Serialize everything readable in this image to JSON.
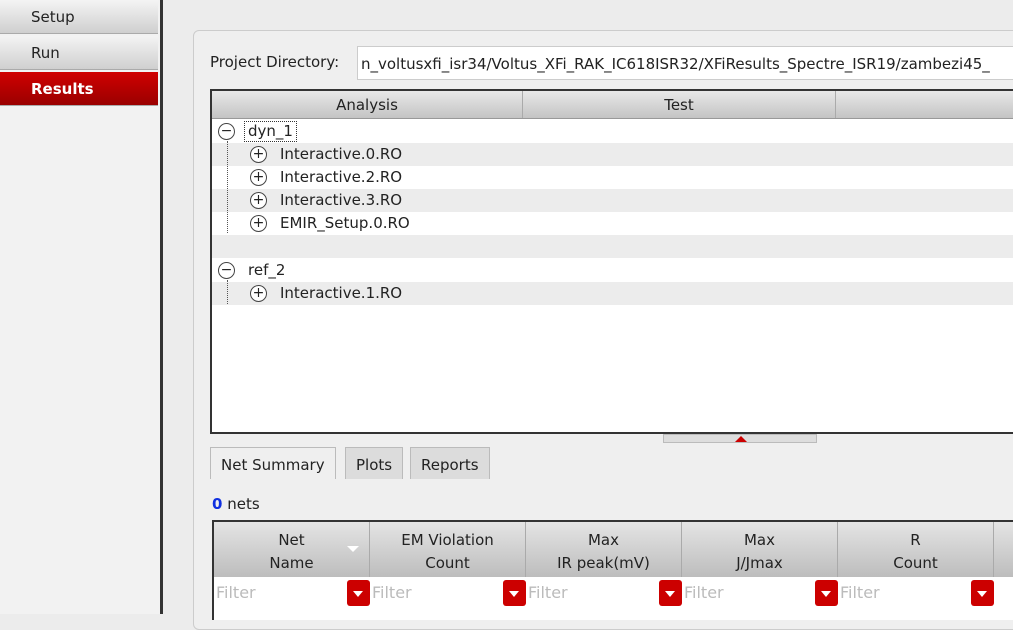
{
  "sidebar": {
    "items": [
      {
        "label": "Setup"
      },
      {
        "label": "Run"
      },
      {
        "label": "Results",
        "active": true
      }
    ]
  },
  "project": {
    "label": "Project Directory:",
    "value": "n_voltusxfi_isr34/Voltus_XFi_RAK_IC618ISR32/XFiResults_Spectre_ISR19/zambezi45_"
  },
  "tree": {
    "columns": [
      "Analysis",
      "Test",
      ""
    ],
    "groups": [
      {
        "name": "dyn_1",
        "children": [
          "Interactive.0.RO",
          "Interactive.2.RO",
          "Interactive.3.RO",
          "EMIR_Setup.0.RO"
        ]
      },
      {
        "name": "ref_2",
        "children": [
          "Interactive.1.RO"
        ]
      }
    ]
  },
  "tabs": [
    "Net Summary",
    "Plots",
    "Reports"
  ],
  "summary": {
    "count": "0",
    "unit": " nets"
  },
  "table": {
    "columns": [
      [
        "Net",
        "Name"
      ],
      [
        "EM Violation",
        "Count"
      ],
      [
        "Max",
        "IR peak(mV)"
      ],
      [
        "Max",
        "J/Jmax"
      ],
      [
        "R",
        "Count"
      ]
    ],
    "filter_placeholder": "Filter"
  },
  "colors": {
    "accent": "#c00000",
    "count": "#1030e0"
  }
}
